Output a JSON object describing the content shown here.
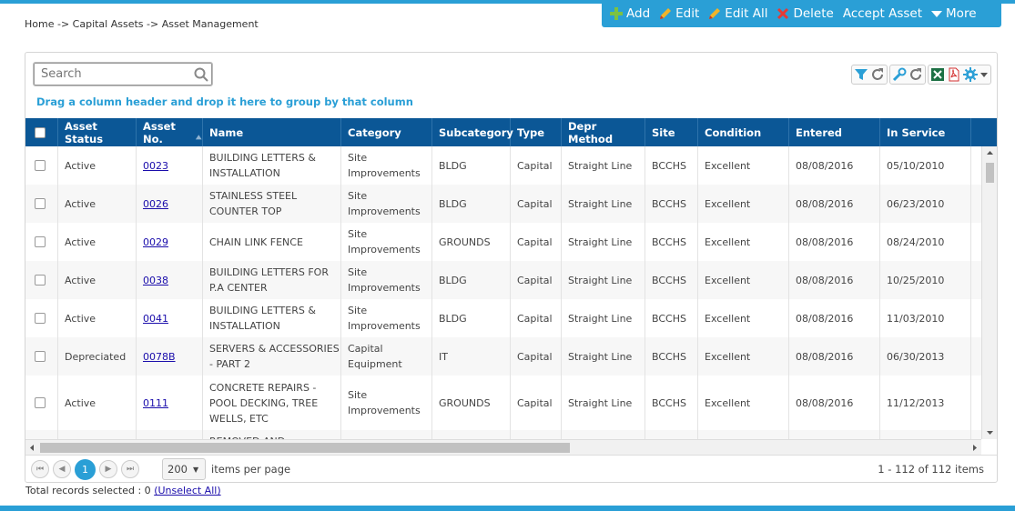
{
  "breadcrumb": "Home -> Capital Assets -> Asset Management",
  "toolbar": {
    "add": "Add",
    "edit": "Edit",
    "edit_all": "Edit All",
    "delete": "Delete",
    "accept_asset": "Accept Asset",
    "more": "More"
  },
  "search": {
    "placeholder": "Search"
  },
  "group_hint": "Drag a column header and drop it here to group by that column",
  "columns": [
    "Asset Status",
    "Asset No.",
    "Name",
    "Category",
    "Subcategory",
    "Type",
    "Depr Method",
    "Site",
    "Condition",
    "Entered",
    "In Service"
  ],
  "rows": [
    {
      "status": "Active",
      "asset_no": "0023",
      "name": "BUILDING LETTERS & INSTALLATION",
      "category": "Site Improvements",
      "subcategory": "BLDG",
      "type": "Capital",
      "depr": "Straight Line",
      "site": "BCCHS",
      "condition": "Excellent",
      "entered": "08/08/2016",
      "in_service": "05/10/2010"
    },
    {
      "status": "Active",
      "asset_no": "0026",
      "name": "STAINLESS STEEL COUNTER TOP",
      "category": "Site Improvements",
      "subcategory": "BLDG",
      "type": "Capital",
      "depr": "Straight Line",
      "site": "BCCHS",
      "condition": "Excellent",
      "entered": "08/08/2016",
      "in_service": "06/23/2010"
    },
    {
      "status": "Active",
      "asset_no": "0029",
      "name": "CHAIN LINK FENCE",
      "category": "Site Improvements",
      "subcategory": "GROUNDS",
      "type": "Capital",
      "depr": "Straight Line",
      "site": "BCCHS",
      "condition": "Excellent",
      "entered": "08/08/2016",
      "in_service": "08/24/2010"
    },
    {
      "status": "Active",
      "asset_no": "0038",
      "name": "BUILDING LETTERS FOR P.A CENTER",
      "category": "Site Improvements",
      "subcategory": "BLDG",
      "type": "Capital",
      "depr": "Straight Line",
      "site": "BCCHS",
      "condition": "Excellent",
      "entered": "08/08/2016",
      "in_service": "10/25/2010"
    },
    {
      "status": "Active",
      "asset_no": "0041",
      "name": "BUILDING LETTERS & INSTALLATION",
      "category": "Site Improvements",
      "subcategory": "BLDG",
      "type": "Capital",
      "depr": "Straight Line",
      "site": "BCCHS",
      "condition": "Excellent",
      "entered": "08/08/2016",
      "in_service": "11/03/2010"
    },
    {
      "status": "Depreciated",
      "asset_no": "0078B",
      "name": "SERVERS & ACCESSORIES - PART 2",
      "category": "Capital Equipment",
      "subcategory": "IT",
      "type": "Capital",
      "depr": "Straight Line",
      "site": "BCCHS",
      "condition": "Excellent",
      "entered": "08/08/2016",
      "in_service": "06/30/2013"
    },
    {
      "status": "Active",
      "asset_no": "0111",
      "name": "CONCRETE REPAIRS - POOL DECKING, TREE WELLS, ETC",
      "category": "Site Improvements",
      "subcategory": "GROUNDS",
      "type": "Capital",
      "depr": "Straight Line",
      "site": "BCCHS",
      "condition": "Excellent",
      "entered": "08/08/2016",
      "in_service": "11/12/2013"
    },
    {
      "status": "",
      "asset_no": "",
      "name": "REMOVED AND REPLACED",
      "category": "Site",
      "subcategory": "",
      "type": "",
      "depr": "",
      "site": "",
      "condition": "",
      "entered": "",
      "in_service": ""
    }
  ],
  "pager": {
    "current_page": "1",
    "per_page": "200",
    "per_page_label": "items per page",
    "summary": "1 - 112 of 112 items"
  },
  "selection": {
    "label": "Total records selected : 0",
    "unselect": "(Unselect All)"
  },
  "colors": {
    "accent": "#2a9fd6",
    "header_bg": "#0b5796"
  }
}
